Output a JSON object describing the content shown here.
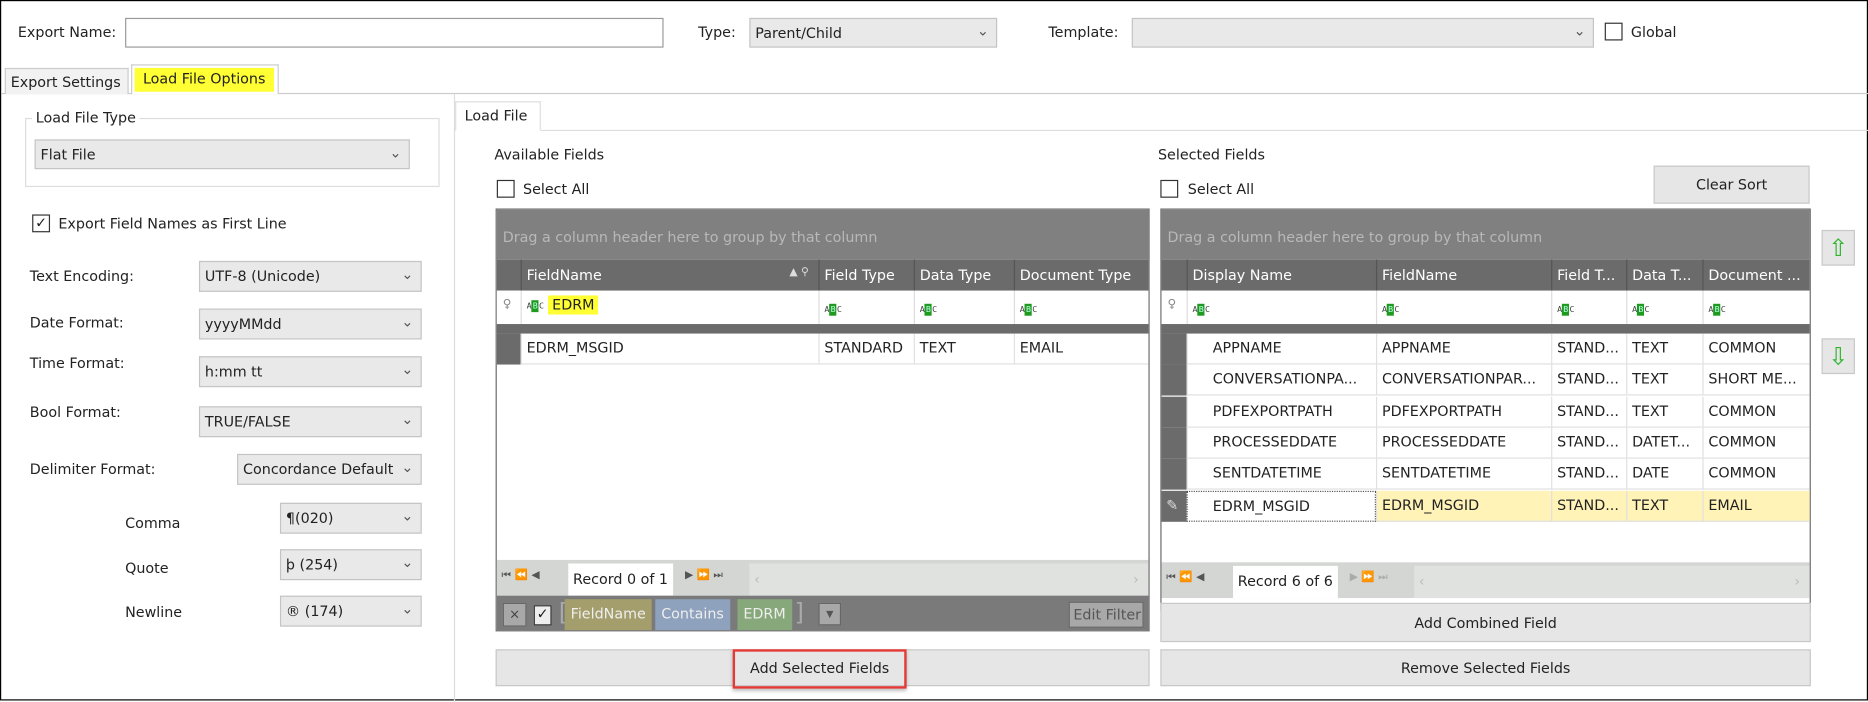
{
  "top": {
    "export_name_label": "Export Name:",
    "export_name_value": "",
    "type_label": "Type:",
    "type_value": "Parent/Child",
    "template_label": "Template:",
    "template_value": "",
    "global_label": "Global",
    "global_checked": false
  },
  "tabs": [
    {
      "label": "Export Settings",
      "active": false
    },
    {
      "label": "Load File Options",
      "active": true,
      "highlight": "#ffff33"
    }
  ],
  "left": {
    "load_file_type_group": "Load File Type",
    "load_file_type": "Flat File",
    "export_field_names_label": "Export Field Names as First Line",
    "export_field_names_checked": true,
    "text_encoding_label": "Text Encoding:",
    "text_encoding": "UTF-8 (Unicode)",
    "date_format_label": "Date Format:",
    "date_format": "yyyyMMdd",
    "time_format_label": "Time Format:",
    "time_format": "h:mm tt",
    "bool_format_label": "Bool Format:",
    "bool_format": "TRUE/FALSE",
    "delimiter_format_label": "Delimiter Format:",
    "delimiter_format": "Concordance Default",
    "comma_label": "Comma",
    "comma": "¶(020)",
    "quote_label": "Quote",
    "quote": "þ (254)",
    "newline_label": "Newline",
    "newline": "® (174)"
  },
  "inner_tab": "Load File",
  "available": {
    "title": "Available Fields",
    "select_all": "Select All",
    "group_hint": "Drag a column header here to group by that column",
    "columns": [
      "FieldName",
      "Field Type",
      "Data Type",
      "Document Type"
    ],
    "filter_value": "EDRM",
    "rows": [
      [
        "EDRM_MSGID",
        "STANDARD",
        "TEXT",
        "EMAIL"
      ]
    ],
    "record_text": "Record 0 of 1",
    "filter": {
      "field": "FieldName",
      "op": "Contains",
      "value": "EDRM",
      "edit_label": "Edit Filter",
      "enabled": true
    },
    "add_button": "Add Selected Fields"
  },
  "selected": {
    "title": "Selected Fields",
    "select_all": "Select All",
    "clear_sort": "Clear Sort",
    "group_hint": "Drag a column header here to group by that column",
    "columns": [
      "Display Name",
      "FieldName",
      "Field T...",
      "Data T...",
      "Document ..."
    ],
    "rows": [
      [
        "APPNAME",
        "APPNAME",
        "STAND...",
        "TEXT",
        "COMMON"
      ],
      [
        "CONVERSATIONPA...",
        "CONVERSATIONPAR...",
        "STAND...",
        "TEXT",
        "SHORT ME..."
      ],
      [
        "PDFEXPORTPATH",
        "PDFEXPORTPATH",
        "STAND...",
        "TEXT",
        "COMMON"
      ],
      [
        "PROCESSEDDATE",
        "PROCESSEDDATE",
        "STAND...",
        "DATET...",
        "COMMON"
      ],
      [
        "SENTDATETIME",
        "SENTDATETIME",
        "STAND...",
        "DATE",
        "COMMON"
      ],
      [
        "EDRM_MSGID",
        "EDRM_MSGID",
        "STAND...",
        "TEXT",
        "EMAIL"
      ]
    ],
    "record_text": "Record 6 of 6",
    "add_combined": "Add Combined Field",
    "remove_button": "Remove Selected Fields"
  },
  "colors": {
    "row_highlight": "#fff3b8",
    "accent_green": "#2fb52f",
    "callout_red": "#e53935"
  }
}
